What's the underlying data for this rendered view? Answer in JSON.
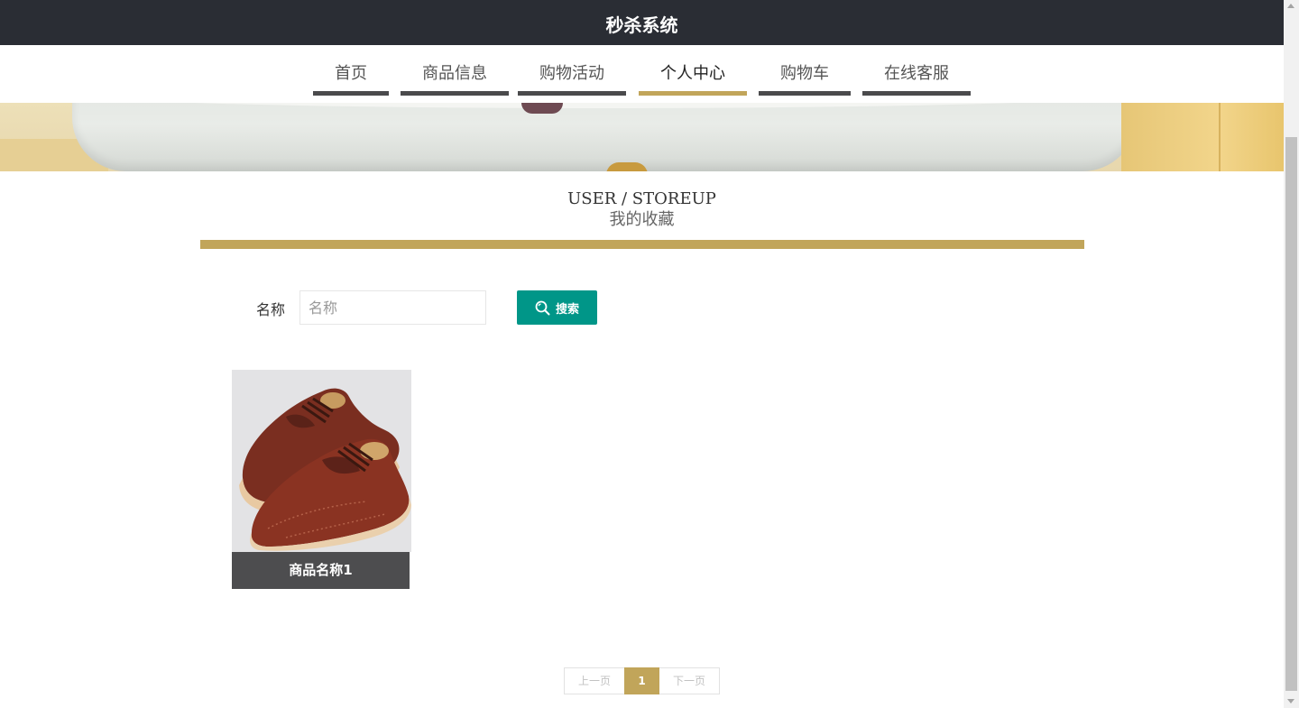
{
  "header": {
    "title": "秒杀系统"
  },
  "nav": {
    "items": [
      {
        "label": "首页",
        "active": false
      },
      {
        "label": "商品信息",
        "active": false
      },
      {
        "label": "购物活动",
        "active": false
      },
      {
        "label": "个人中心",
        "active": true
      },
      {
        "label": "购物车",
        "active": false
      },
      {
        "label": "在线客服",
        "active": false
      }
    ]
  },
  "section": {
    "title_en": "USER / STOREUP",
    "title_cn": "我的收藏"
  },
  "search": {
    "label": "名称",
    "placeholder": "名称",
    "value": "",
    "button_label": "搜索"
  },
  "products": [
    {
      "name": "商品名称1",
      "image": "brown-leather-brogue-shoes"
    }
  ],
  "pagination": {
    "prev_label": "上一页",
    "current": "1",
    "next_label": "下一页"
  },
  "colors": {
    "accent": "#c1a55a",
    "header_bg": "#2a2d34",
    "search_button": "#009688",
    "card_label_bg": "#4d4d4f"
  }
}
